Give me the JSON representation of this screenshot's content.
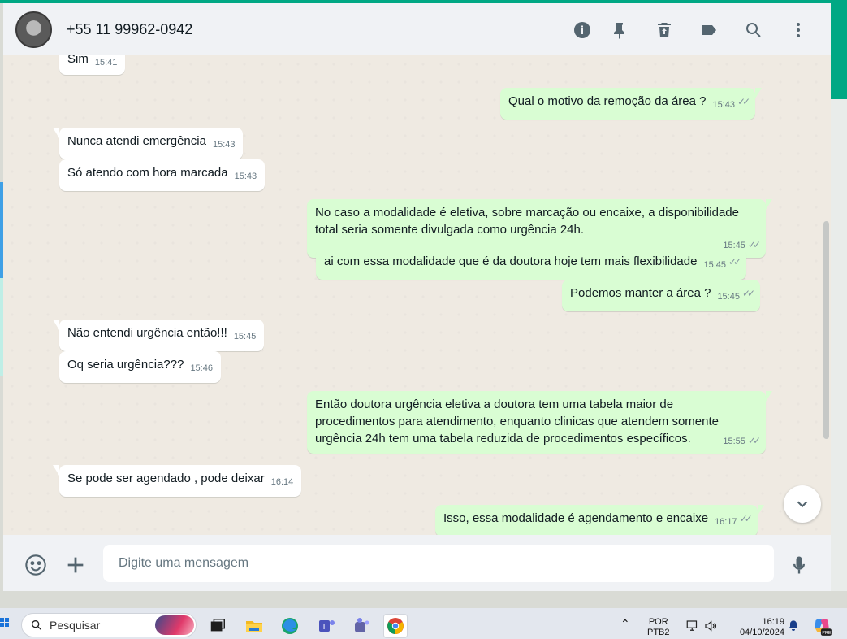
{
  "header": {
    "contact_name": "+55 11 99962-0942"
  },
  "messages": [
    {
      "dir": "in",
      "text": "Sim",
      "time": "15:41"
    },
    {
      "dir": "out",
      "text": "Qual o motivo da remoção da área ?",
      "time": "15:43"
    },
    {
      "dir": "in",
      "text": "Nunca atendi emergência",
      "time": "15:43"
    },
    {
      "dir": "in",
      "text": "Só atendo com hora marcada",
      "time": "15:43"
    },
    {
      "dir": "out",
      "text": "No caso a modalidade é eletiva, sobre marcação ou encaixe, a disponibilidade total seria somente divulgada como urgência 24h.",
      "time": "15:45"
    },
    {
      "dir": "out",
      "text": "ai com essa modalidade que é da doutora hoje tem mais flexibilidade",
      "time": "15:45"
    },
    {
      "dir": "out",
      "text": "Podemos manter a área ?",
      "time": "15:45"
    },
    {
      "dir": "in",
      "text": "Não entendi urgência então!!!",
      "time": "15:45"
    },
    {
      "dir": "in",
      "text": "Oq seria urgência???",
      "time": "15:46"
    },
    {
      "dir": "out",
      "text": "Então doutora urgência eletiva a doutora tem uma tabela maior de procedimentos para atendimento, enquanto clinicas que atendem somente urgência 24h tem uma tabela reduzida de procedimentos específicos.",
      "time": "15:55"
    },
    {
      "dir": "in",
      "text": "Se pode ser agendado , pode deixar",
      "time": "16:14"
    },
    {
      "dir": "out",
      "text": "Isso, essa modalidade é agendamento e encaixe",
      "time": "16:17"
    }
  ],
  "composer": {
    "placeholder": "Digite uma mensagem"
  },
  "taskbar": {
    "search_label": "Pesquisar",
    "lang_top": "POR",
    "lang_bottom": "PTB2",
    "time": "16:19",
    "date": "04/10/2024",
    "copilot_badge": "PRE"
  },
  "colors": {
    "accent": "#00a884",
    "outgoing_bubble": "#d9fdd3",
    "incoming_bubble": "#ffffff",
    "chat_bg": "#efeae2"
  }
}
